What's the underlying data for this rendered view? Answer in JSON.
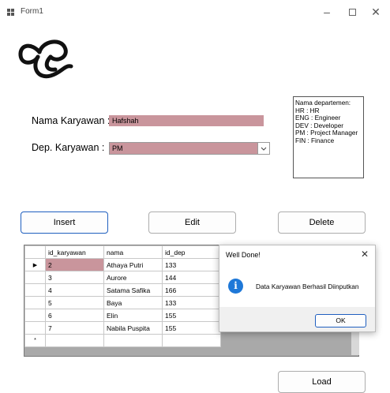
{
  "window": {
    "title": "Form1",
    "minimize_icon": "minimize-icon",
    "maximize_icon": "maximize-icon",
    "close_icon": "close-icon"
  },
  "form": {
    "nama_label": "Nama Karyawan :",
    "nama_value": "Hafshah",
    "dep_label": "Dep. Karyawan :",
    "dep_value": "PM",
    "info_text": "Nama departemen:\nHR : HR\nENG : Engineer\nDEV : Developer\nPM : Project Manager\nFIN : Finance"
  },
  "buttons": {
    "insert": "Insert",
    "edit": "Edit",
    "delete": "Delete",
    "load": "Load"
  },
  "grid": {
    "columns": [
      "id_karyawan",
      "nama",
      "id_dep"
    ],
    "rows": [
      [
        "2",
        "Athaya Putri",
        "133"
      ],
      [
        "3",
        "Aurore",
        "144"
      ],
      [
        "4",
        "Satama Safika",
        "166"
      ],
      [
        "5",
        "Baya",
        "133"
      ],
      [
        "6",
        "Elin",
        "155"
      ],
      [
        "7",
        "Nabila Puspita",
        "155"
      ]
    ],
    "current_row_marker": "▶",
    "new_row_marker": "*"
  },
  "dialog": {
    "title": "Well Done!",
    "message": "Data Karyawan Berhasil Diinputkan",
    "ok": "OK",
    "icon": "info-icon"
  },
  "colors": {
    "field_bg": "#c9959c",
    "accent": "#1f5fbf",
    "info_icon": "#1e78d8"
  }
}
